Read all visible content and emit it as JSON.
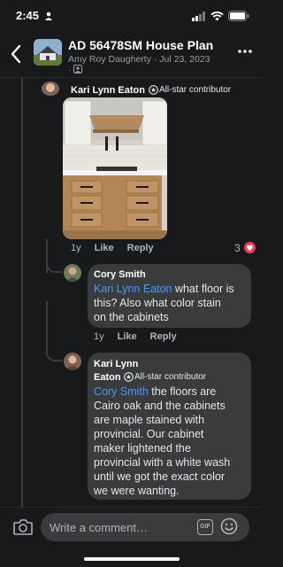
{
  "status": {
    "time": "2:45"
  },
  "header": {
    "title": "AD 56478SM House Plan",
    "author": "Amy Roy Daugherty",
    "date": "Jul 23, 2023"
  },
  "comments": [
    {
      "author": "Kari Lynn Eaton",
      "badge": "All-star contributor",
      "age": "1y",
      "like": "Like",
      "reply": "Reply",
      "reaction_count": "3"
    },
    {
      "author": "Cory Smith",
      "mention": "Kari Lynn Eaton",
      "text_line1_rest": " what floor is",
      "text_line2": "this? Also what color stain",
      "text_line3": "on the cabinets",
      "age": "1y",
      "like": "Like",
      "reply": "Reply"
    },
    {
      "author_line1": "Kari Lynn",
      "author_line2": "Eaton",
      "badge": "All-star contributor",
      "mention": "Cory Smith",
      "text_line1_rest": " the floors are",
      "text_lines": [
        "Cairo oak and the cabinets",
        "are maple stained with",
        "provincial. Our cabinet",
        "maker lightened the",
        "provincial with a white wash",
        "until we got the exact color",
        "we were wanting."
      ]
    }
  ],
  "composer": {
    "placeholder": "Write a comment…",
    "gif_label": "GIF"
  },
  "colors": {
    "background": "#18191a",
    "bubble": "#3a3b3c",
    "mention": "#4599ff",
    "heart": "#f33e58"
  }
}
